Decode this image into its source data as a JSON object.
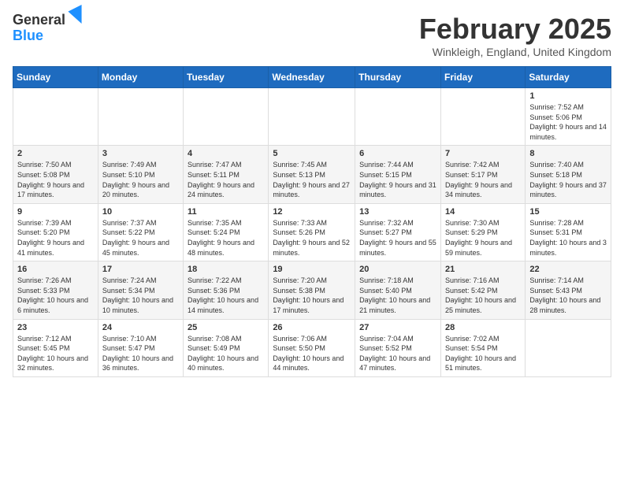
{
  "header": {
    "logo_general": "General",
    "logo_blue": "Blue",
    "month_title": "February 2025",
    "location": "Winkleigh, England, United Kingdom"
  },
  "days_of_week": [
    "Sunday",
    "Monday",
    "Tuesday",
    "Wednesday",
    "Thursday",
    "Friday",
    "Saturday"
  ],
  "weeks": [
    {
      "cells": [
        {
          "day": "",
          "info": ""
        },
        {
          "day": "",
          "info": ""
        },
        {
          "day": "",
          "info": ""
        },
        {
          "day": "",
          "info": ""
        },
        {
          "day": "",
          "info": ""
        },
        {
          "day": "",
          "info": ""
        },
        {
          "day": "1",
          "info": "Sunrise: 7:52 AM\nSunset: 5:06 PM\nDaylight: 9 hours and 14 minutes."
        }
      ]
    },
    {
      "cells": [
        {
          "day": "2",
          "info": "Sunrise: 7:50 AM\nSunset: 5:08 PM\nDaylight: 9 hours and 17 minutes."
        },
        {
          "day": "3",
          "info": "Sunrise: 7:49 AM\nSunset: 5:10 PM\nDaylight: 9 hours and 20 minutes."
        },
        {
          "day": "4",
          "info": "Sunrise: 7:47 AM\nSunset: 5:11 PM\nDaylight: 9 hours and 24 minutes."
        },
        {
          "day": "5",
          "info": "Sunrise: 7:45 AM\nSunset: 5:13 PM\nDaylight: 9 hours and 27 minutes."
        },
        {
          "day": "6",
          "info": "Sunrise: 7:44 AM\nSunset: 5:15 PM\nDaylight: 9 hours and 31 minutes."
        },
        {
          "day": "7",
          "info": "Sunrise: 7:42 AM\nSunset: 5:17 PM\nDaylight: 9 hours and 34 minutes."
        },
        {
          "day": "8",
          "info": "Sunrise: 7:40 AM\nSunset: 5:18 PM\nDaylight: 9 hours and 37 minutes."
        }
      ]
    },
    {
      "cells": [
        {
          "day": "9",
          "info": "Sunrise: 7:39 AM\nSunset: 5:20 PM\nDaylight: 9 hours and 41 minutes."
        },
        {
          "day": "10",
          "info": "Sunrise: 7:37 AM\nSunset: 5:22 PM\nDaylight: 9 hours and 45 minutes."
        },
        {
          "day": "11",
          "info": "Sunrise: 7:35 AM\nSunset: 5:24 PM\nDaylight: 9 hours and 48 minutes."
        },
        {
          "day": "12",
          "info": "Sunrise: 7:33 AM\nSunset: 5:26 PM\nDaylight: 9 hours and 52 minutes."
        },
        {
          "day": "13",
          "info": "Sunrise: 7:32 AM\nSunset: 5:27 PM\nDaylight: 9 hours and 55 minutes."
        },
        {
          "day": "14",
          "info": "Sunrise: 7:30 AM\nSunset: 5:29 PM\nDaylight: 9 hours and 59 minutes."
        },
        {
          "day": "15",
          "info": "Sunrise: 7:28 AM\nSunset: 5:31 PM\nDaylight: 10 hours and 3 minutes."
        }
      ]
    },
    {
      "cells": [
        {
          "day": "16",
          "info": "Sunrise: 7:26 AM\nSunset: 5:33 PM\nDaylight: 10 hours and 6 minutes."
        },
        {
          "day": "17",
          "info": "Sunrise: 7:24 AM\nSunset: 5:34 PM\nDaylight: 10 hours and 10 minutes."
        },
        {
          "day": "18",
          "info": "Sunrise: 7:22 AM\nSunset: 5:36 PM\nDaylight: 10 hours and 14 minutes."
        },
        {
          "day": "19",
          "info": "Sunrise: 7:20 AM\nSunset: 5:38 PM\nDaylight: 10 hours and 17 minutes."
        },
        {
          "day": "20",
          "info": "Sunrise: 7:18 AM\nSunset: 5:40 PM\nDaylight: 10 hours and 21 minutes."
        },
        {
          "day": "21",
          "info": "Sunrise: 7:16 AM\nSunset: 5:42 PM\nDaylight: 10 hours and 25 minutes."
        },
        {
          "day": "22",
          "info": "Sunrise: 7:14 AM\nSunset: 5:43 PM\nDaylight: 10 hours and 28 minutes."
        }
      ]
    },
    {
      "cells": [
        {
          "day": "23",
          "info": "Sunrise: 7:12 AM\nSunset: 5:45 PM\nDaylight: 10 hours and 32 minutes."
        },
        {
          "day": "24",
          "info": "Sunrise: 7:10 AM\nSunset: 5:47 PM\nDaylight: 10 hours and 36 minutes."
        },
        {
          "day": "25",
          "info": "Sunrise: 7:08 AM\nSunset: 5:49 PM\nDaylight: 10 hours and 40 minutes."
        },
        {
          "day": "26",
          "info": "Sunrise: 7:06 AM\nSunset: 5:50 PM\nDaylight: 10 hours and 44 minutes."
        },
        {
          "day": "27",
          "info": "Sunrise: 7:04 AM\nSunset: 5:52 PM\nDaylight: 10 hours and 47 minutes."
        },
        {
          "day": "28",
          "info": "Sunrise: 7:02 AM\nSunset: 5:54 PM\nDaylight: 10 hours and 51 minutes."
        },
        {
          "day": "",
          "info": ""
        }
      ]
    }
  ]
}
